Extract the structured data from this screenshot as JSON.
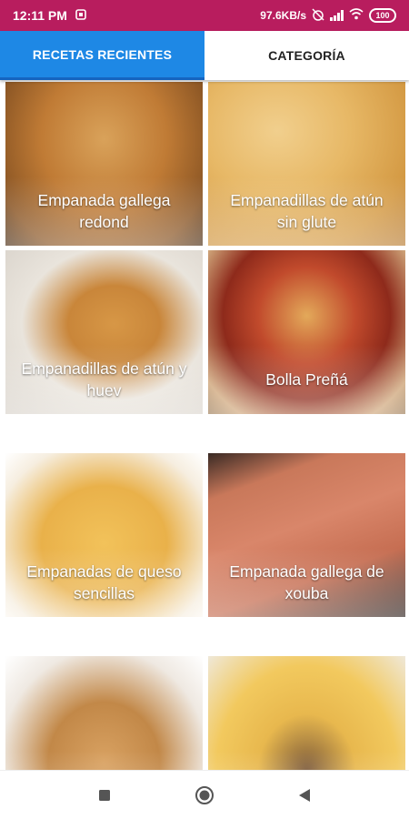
{
  "status_bar": {
    "time": "12:11 PM",
    "network_speed": "97.6KB/s",
    "battery": "100",
    "icons": [
      "notification-icon",
      "alarm-off-icon",
      "signal-icon",
      "wifi-icon",
      "battery-icon"
    ]
  },
  "tabs": [
    {
      "label": "RECETAS RECIENTES",
      "active": true
    },
    {
      "label": "CATEGORÍA",
      "active": false
    }
  ],
  "recipes": [
    {
      "title": "Empanada gallega redond"
    },
    {
      "title": "Empanadillas de atún sin glute"
    },
    {
      "title": "Empanadillas de atún y huev"
    },
    {
      "title": "Bolla Preñá"
    },
    {
      "title": "Empanadas de queso sencillas"
    },
    {
      "title": "Empanada gallega de xouba"
    },
    {
      "title": ""
    },
    {
      "title": ""
    }
  ],
  "nav_bar": {
    "icons": [
      "recent-apps-icon",
      "home-icon",
      "back-icon"
    ]
  },
  "colors": {
    "status_bar": "#b81d5e",
    "tab_active": "#1e88e5"
  }
}
